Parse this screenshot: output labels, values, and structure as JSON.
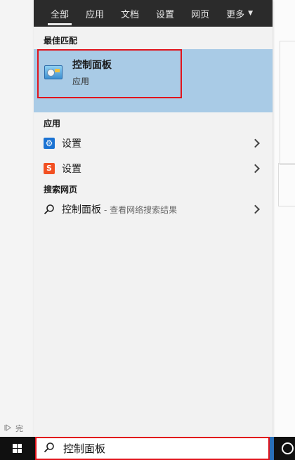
{
  "tabs": [
    {
      "label": "全部",
      "active": true
    },
    {
      "label": "应用"
    },
    {
      "label": "文档"
    },
    {
      "label": "设置"
    },
    {
      "label": "网页"
    },
    {
      "label": "更多"
    }
  ],
  "best_match": {
    "heading": "最佳匹配",
    "title": "控制面板",
    "subtitle": "应用"
  },
  "apps": {
    "heading": "应用",
    "items": [
      {
        "label": "设置",
        "icon": "gear-icon"
      },
      {
        "label": "设置",
        "icon": "sogou-s-icon"
      }
    ]
  },
  "web": {
    "heading": "搜索网页",
    "query": "控制面板",
    "hint": "- 查看网络搜索结果"
  },
  "background": {
    "status_char": "完"
  },
  "search": {
    "value": "控制面板"
  },
  "colors": {
    "accent_red": "#e1141c",
    "selection_blue": "#a9cbe6",
    "tab_bar": "#2b2b2b",
    "taskbar": "#101010"
  }
}
